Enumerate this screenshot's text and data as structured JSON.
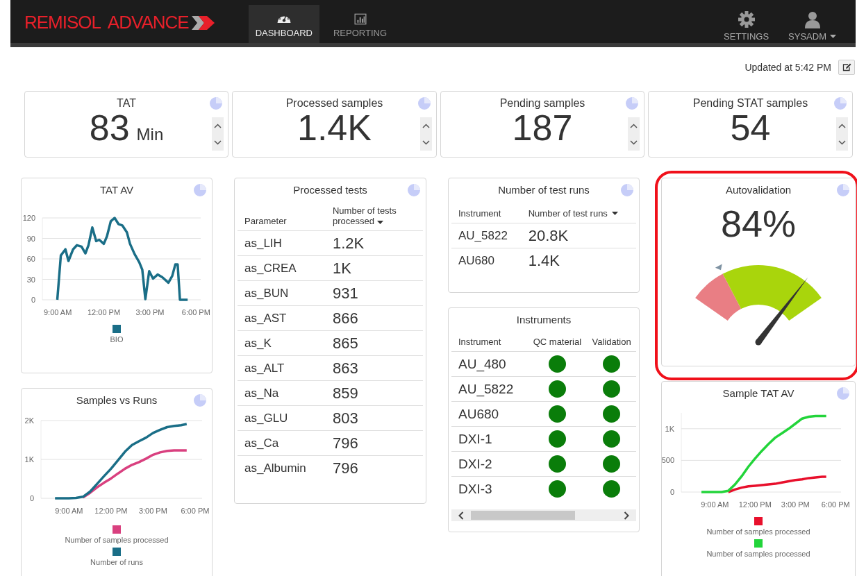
{
  "nav": {
    "logo": "REMISOL ADVANCE",
    "tabs": [
      {
        "label": "DASHBOARD",
        "kind": "dashboard",
        "selected": true
      },
      {
        "label": "REPORTING",
        "kind": "reporting",
        "selected": false
      }
    ],
    "right": [
      {
        "label": "SETTINGS",
        "kind": "settings"
      },
      {
        "label": "SYSADM",
        "kind": "user"
      }
    ]
  },
  "updated": "Updated at 5:42 PM",
  "kpis": [
    {
      "title": "TAT",
      "value": "83",
      "unit": "Min"
    },
    {
      "title": "Processed samples",
      "value": "1.4K"
    },
    {
      "title": "Pending samples",
      "value": "187"
    },
    {
      "title": "Pending STAT samples",
      "value": "54"
    }
  ],
  "tat_av": {
    "title": "TAT AV",
    "chart_data": {
      "type": "line",
      "x": [
        8.97,
        9.2,
        9.5,
        9.7,
        10.0,
        10.25,
        10.55,
        10.8,
        11.0,
        11.25,
        11.5,
        11.7,
        12.0,
        12.2,
        12.45,
        12.7,
        12.95,
        13.2,
        13.5,
        13.7,
        14.0,
        14.3,
        14.5,
        14.7,
        14.95,
        15.2,
        15.5,
        15.8,
        16.2,
        16.45,
        16.65,
        16.8,
        16.95,
        17.45
      ],
      "xlim": [
        8,
        18.3
      ],
      "ylim": [
        0,
        120
      ],
      "grid": true,
      "legend": "bottom",
      "xticks": [
        {
          "value": 9,
          "label": "9:00 AM"
        },
        {
          "value": 12,
          "label": "12:00 PM"
        },
        {
          "value": 15,
          "label": "3:00 PM"
        },
        {
          "value": 18,
          "label": "6:00 PM"
        }
      ],
      "yticks": [
        0,
        30,
        60,
        90,
        120
      ],
      "series": [
        {
          "name": "BIO",
          "color": "#1a6e87",
          "values": [
            0,
            65,
            74,
            57,
            74,
            80,
            78,
            68,
            80,
            106,
            86,
            88,
            82,
            93,
            115,
            120,
            111,
            109,
            99,
            82,
            67,
            55,
            44,
            1,
            42,
            31,
            37,
            33,
            25,
            35,
            52,
            52,
            0,
            0
          ]
        }
      ]
    }
  },
  "samples_vs_runs": {
    "title": "Samples vs Runs",
    "chart_data": {
      "type": "line",
      "x": [
        8,
        8.5,
        9,
        9.5,
        10,
        10.5,
        11,
        11.5,
        12,
        12.5,
        13,
        13.5,
        14,
        14.5,
        15,
        15.5,
        16,
        16.5,
        17,
        17.4
      ],
      "xlim": [
        7,
        18.5
      ],
      "ylim": [
        0,
        2000
      ],
      "grid": true,
      "legend": "bottom",
      "xticks": [
        {
          "value": 9,
          "label": "9:00 AM"
        },
        {
          "value": 12,
          "label": "12:00 PM"
        },
        {
          "value": 15,
          "label": "3:00 PM"
        },
        {
          "value": 18,
          "label": "6:00 PM"
        }
      ],
      "yticks": [
        {
          "value": 0,
          "label": "0"
        },
        {
          "value": 1000,
          "label": "1K"
        },
        {
          "value": 2000,
          "label": "2K"
        }
      ],
      "series": [
        {
          "name": "Number of samples processed",
          "color": "#d9407f",
          "values": [
            null,
            null,
            null,
            null,
            20,
            140,
            280,
            400,
            510,
            640,
            760,
            860,
            930,
            1020,
            1120,
            1180,
            1220,
            1230,
            1230,
            1230
          ]
        },
        {
          "name": "Number of runs",
          "color": "#1a6e87",
          "values": [
            0,
            0,
            0,
            10,
            40,
            170,
            370,
            570,
            760,
            980,
            1200,
            1370,
            1470,
            1560,
            1680,
            1760,
            1830,
            1860,
            1880,
            1910
          ]
        }
      ]
    }
  },
  "processed_tests": {
    "title": "Processed tests",
    "columns": [
      "Parameter",
      "Number of tests processed"
    ],
    "rows": [
      [
        "as_LIH",
        "1.2K"
      ],
      [
        "as_CREA",
        "1K"
      ],
      [
        "as_BUN",
        "931"
      ],
      [
        "as_AST",
        "866"
      ],
      [
        "as_K",
        "865"
      ],
      [
        "as_ALT",
        "863"
      ],
      [
        "as_Na",
        "859"
      ],
      [
        "as_GLU",
        "803"
      ],
      [
        "as_Ca",
        "796"
      ],
      [
        "as_Albumin",
        "796"
      ]
    ]
  },
  "test_runs": {
    "title": "Number of test runs",
    "columns": [
      "Instrument",
      "Number of test runs"
    ],
    "rows": [
      [
        "AU_5822",
        "20.8K"
      ],
      [
        "AU680",
        "1.4K"
      ]
    ]
  },
  "instruments": {
    "title": "Instruments",
    "columns": [
      "Instrument",
      "QC material",
      "Validation"
    ],
    "rows": [
      {
        "name": "AU_480",
        "qc_material": {
          "color": "#0a7d0a"
        },
        "validation": {
          "color": "#0a7d0a"
        }
      },
      {
        "name": "AU_5822",
        "qc_material": {
          "color": "#0a7d0a"
        },
        "validation": {
          "color": "#0a7d0a"
        }
      },
      {
        "name": "AU680",
        "qc_material": {
          "color": "#0a7d0a"
        },
        "validation": {
          "color": "#0a7d0a"
        }
      },
      {
        "name": "DXI-1",
        "qc_material": {
          "color": "#0a7d0a"
        },
        "validation": {
          "color": "#0a7d0a"
        }
      },
      {
        "name": "DXI-2",
        "qc_material": {
          "color": "#0a7d0a"
        },
        "validation": {
          "color": "#0a7d0a"
        }
      },
      {
        "name": "DXI-3",
        "qc_material": {
          "color": "#0a7d0a"
        },
        "validation": {
          "color": "#0a7d0a"
        }
      }
    ]
  },
  "autovalidation": {
    "title": "Autovalidation",
    "value": "84%",
    "highlighted": true
  },
  "sample_tat_av": {
    "title": "Sample TAT AV",
    "chart_data": {
      "type": "line",
      "x": [
        8,
        8.5,
        9,
        9.5,
        10,
        10.5,
        11,
        11.5,
        12,
        12.5,
        13,
        13.5,
        14,
        14.5,
        15,
        15.5,
        16,
        16.5,
        17,
        17.3
      ],
      "xlim": [
        6.5,
        18.4
      ],
      "ylim": [
        0,
        1250
      ],
      "grid": true,
      "legend": "bottom",
      "xticks": [
        {
          "value": 9,
          "label": "9:00 AM"
        },
        {
          "value": 12,
          "label": "12:00 PM"
        },
        {
          "value": 15,
          "label": "3:00 PM"
        },
        {
          "value": 18,
          "label": "6:00 PM"
        }
      ],
      "yticks": [
        {
          "value": 0,
          "label": "0"
        },
        {
          "value": 500,
          "label": "500"
        },
        {
          "value": 1000,
          "label": "1K"
        }
      ],
      "series": [
        {
          "name": "Number of samples processed",
          "color": "#e8102c",
          "values": [
            null,
            null,
            null,
            null,
            0,
            40,
            70,
            90,
            100,
            110,
            120,
            130,
            150,
            170,
            190,
            200,
            220,
            230,
            240,
            240
          ]
        },
        {
          "name": "Number of samples processed",
          "color": "#22d43a",
          "values": [
            0,
            0,
            0,
            0,
            20,
            120,
            250,
            400,
            530,
            650,
            760,
            860,
            930,
            1000,
            1080,
            1160,
            1190,
            1200,
            1200,
            1200
          ]
        }
      ]
    }
  }
}
